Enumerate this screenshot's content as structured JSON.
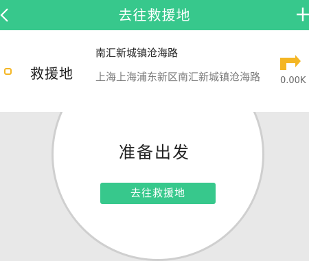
{
  "header": {
    "title": "去往救援地",
    "back_icon": "chevron-left-icon",
    "add_icon": "plus-icon",
    "background_color": "#37c88c"
  },
  "destination": {
    "label": "救援地",
    "marker_icon": "location-marker-icon",
    "marker_color": "#f4b624",
    "road": "南汇新城镇沧海路",
    "address": "上海上海浦东新区南汇新城镇沧海路",
    "nav_icon": "navigation-arrow-icon",
    "distance": "0.00K"
  },
  "status": {
    "text": "准备出发"
  },
  "action": {
    "go_label": "去往救援地"
  }
}
